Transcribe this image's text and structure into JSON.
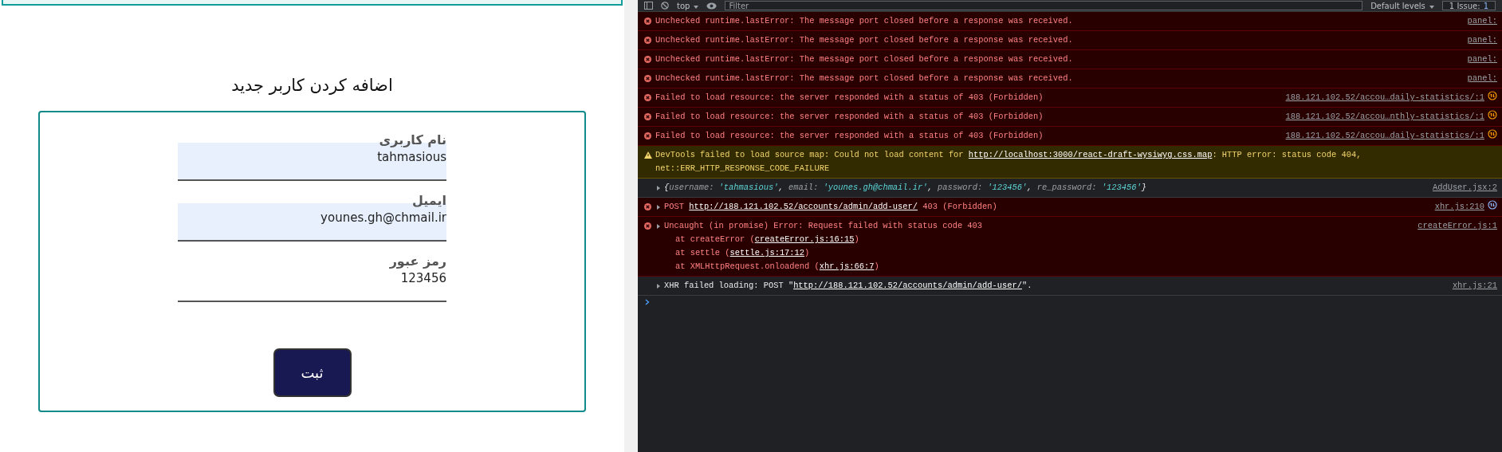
{
  "form": {
    "title": "اضافه کردن کاربر جدید",
    "fields": [
      {
        "label": "نام کاربری",
        "value": "tahmasious",
        "autofilled": true
      },
      {
        "label": "ایمیل",
        "value": "younes.gh@chmail.ir",
        "autofilled": true
      },
      {
        "label": "رمز عبور",
        "value": "123456",
        "autofilled": false
      }
    ],
    "submit": "ثبت"
  },
  "devtools": {
    "toolbar": {
      "context": "top",
      "filter_placeholder": "Filter",
      "levels": "Default levels",
      "issues_label": "1 Issue:",
      "issues_count": "1"
    },
    "messages": [
      {
        "kind": "error",
        "expandable": false,
        "lines": [
          [
            {
              "kind": "plain",
              "text": "Unchecked runtime.lastError: The message port closed before a response was received."
            }
          ]
        ],
        "source": "panel:"
      },
      {
        "kind": "error",
        "expandable": false,
        "lines": [
          [
            {
              "kind": "plain",
              "text": "Unchecked runtime.lastError: The message port closed before a response was received."
            }
          ]
        ],
        "source": "panel:"
      },
      {
        "kind": "error",
        "expandable": false,
        "lines": [
          [
            {
              "kind": "plain",
              "text": "Unchecked runtime.lastError: The message port closed before a response was received."
            }
          ]
        ],
        "source": "panel:"
      },
      {
        "kind": "error",
        "expandable": false,
        "lines": [
          [
            {
              "kind": "plain",
              "text": "Unchecked runtime.lastError: The message port closed before a response was received."
            }
          ]
        ],
        "source": "panel:"
      },
      {
        "kind": "error",
        "expandable": false,
        "lines": [
          [
            {
              "kind": "plain",
              "text": "Failed to load resource: the server responded with a status of 403 (Forbidden)"
            }
          ]
        ],
        "source": "188.121.102.52/accou…daily-statistics/:1",
        "network": {
          "kind": "failed"
        }
      },
      {
        "kind": "error",
        "expandable": false,
        "lines": [
          [
            {
              "kind": "plain",
              "text": "Failed to load resource: the server responded with a status of 403 (Forbidden)"
            }
          ]
        ],
        "source": "188.121.102.52/accou…nthly-statistics/:1",
        "network": {
          "kind": "failed"
        }
      },
      {
        "kind": "error",
        "expandable": false,
        "lines": [
          [
            {
              "kind": "plain",
              "text": "Failed to load resource: the server responded with a status of 403 (Forbidden)"
            }
          ]
        ],
        "source": "188.121.102.52/accou…daily-statistics/:1",
        "network": {
          "kind": "failed"
        }
      },
      {
        "kind": "warning",
        "expandable": false,
        "lines": [
          [
            {
              "kind": "plain",
              "text": "DevTools failed to load source map: Could not load content for "
            },
            {
              "kind": "link",
              "text": "http://localhost:3000/react-draft-wysiwyg.css.map"
            },
            {
              "kind": "plain",
              "text": ": HTTP error: status code 404,"
            }
          ],
          [
            {
              "kind": "plain",
              "text": "net::ERR_HTTP_RESPONSE_CODE_FAILURE"
            }
          ]
        ]
      },
      {
        "kind": "log",
        "expandable": true,
        "lines": [
          [
            {
              "kind": "plain",
              "text": "{"
            },
            {
              "kind": "key",
              "text": "username: "
            },
            {
              "kind": "string",
              "text": "'tahmasious'"
            },
            {
              "kind": "plain",
              "text": ", "
            },
            {
              "kind": "key",
              "text": "email: "
            },
            {
              "kind": "string",
              "text": "'younes.gh@chmail.ir'"
            },
            {
              "kind": "plain",
              "text": ", "
            },
            {
              "kind": "key",
              "text": "password: "
            },
            {
              "kind": "string",
              "text": "'123456'"
            },
            {
              "kind": "plain",
              "text": ", "
            },
            {
              "kind": "key",
              "text": "re_password: "
            },
            {
              "kind": "string",
              "text": "'123456'"
            },
            {
              "kind": "plain",
              "text": "}"
            }
          ]
        ],
        "source": "AddUser.jsx:2"
      },
      {
        "kind": "error",
        "expandable": true,
        "lines": [
          [
            {
              "kind": "plain",
              "text": "POST "
            },
            {
              "kind": "link",
              "text": "http://188.121.102.52/accounts/admin/add-user/"
            },
            {
              "kind": "plain",
              "text": " 403 (Forbidden)"
            }
          ]
        ],
        "source": "xhr.js:210",
        "network": {
          "kind": "request"
        }
      },
      {
        "kind": "error",
        "expandable": true,
        "lines": [
          [
            {
              "kind": "plain",
              "text": "Uncaught (in promise) Error: Request failed with status code 403"
            }
          ],
          [
            {
              "kind": "plain",
              "text": "    at createError ("
            },
            {
              "kind": "link",
              "text": "createError.js:16:15"
            },
            {
              "kind": "plain",
              "text": ")"
            }
          ],
          [
            {
              "kind": "plain",
              "text": "    at settle ("
            },
            {
              "kind": "link",
              "text": "settle.js:17:12"
            },
            {
              "kind": "plain",
              "text": ")"
            }
          ],
          [
            {
              "kind": "plain",
              "text": "    at XMLHttpRequest.onloadend ("
            },
            {
              "kind": "link",
              "text": "xhr.js:66:7"
            },
            {
              "kind": "plain",
              "text": ")"
            }
          ]
        ],
        "source": "createError.js:1"
      },
      {
        "kind": "log",
        "expandable": true,
        "lines": [
          [
            {
              "kind": "plain",
              "text": "XHR failed loading: POST \""
            },
            {
              "kind": "link",
              "text": "http://188.121.102.52/accounts/admin/add-user/"
            },
            {
              "kind": "plain",
              "text": "\"."
            }
          ]
        ],
        "source": "xhr.js:21"
      }
    ]
  }
}
